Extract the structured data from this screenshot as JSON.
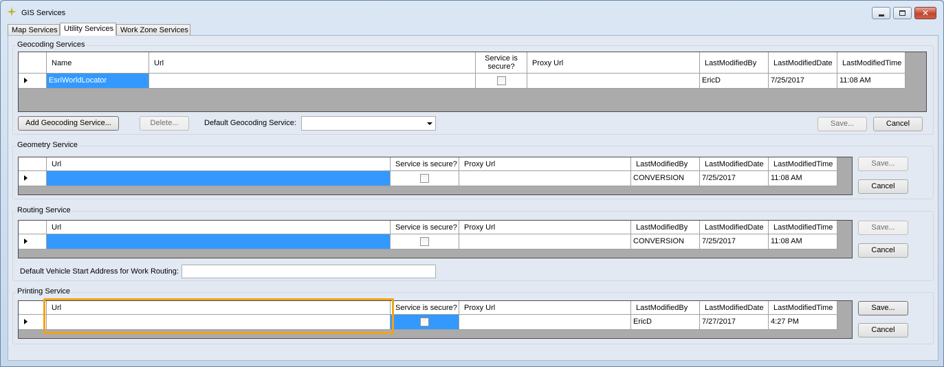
{
  "window": {
    "title": "GIS Services"
  },
  "tabs": [
    "Map Services",
    "Utility Services",
    "Work Zone Services"
  ],
  "geocoding": {
    "group_title": "Geocoding Services",
    "columns": [
      "Name",
      "Url",
      "Service is secure?",
      "Proxy Url",
      "LastModifiedBy",
      "LastModifiedDate",
      "LastModifiedTime"
    ],
    "row": {
      "name": "EsriWorldLocator",
      "url": "",
      "secure": false,
      "proxy_url": "",
      "modified_by": "EricD",
      "modified_date": "7/25/2017",
      "modified_time": "11:08 AM"
    },
    "add_button": "Add Geocoding Service...",
    "delete_button": "Delete...",
    "default_label": "Default Geocoding Service:",
    "default_value": "",
    "save_button": "Save...",
    "cancel_button": "Cancel"
  },
  "geometry": {
    "group_title": "Geometry Service",
    "columns": [
      "Url",
      "Service is secure?",
      "Proxy Url",
      "LastModifiedBy",
      "LastModifiedDate",
      "LastModifiedTime"
    ],
    "row": {
      "url": "",
      "secure": false,
      "proxy_url": "",
      "modified_by": "CONVERSION",
      "modified_date": "7/25/2017",
      "modified_time": "11:08 AM"
    },
    "save_button": "Save...",
    "cancel_button": "Cancel"
  },
  "routing": {
    "group_title": "Routing Service",
    "columns": [
      "Url",
      "Service is secure?",
      "Proxy Url",
      "LastModifiedBy",
      "LastModifiedDate",
      "LastModifiedTime"
    ],
    "row": {
      "url": "",
      "secure": false,
      "proxy_url": "",
      "modified_by": "CONVERSION",
      "modified_date": "7/25/2017",
      "modified_time": "11:08 AM"
    },
    "start_address_label": "Default Vehicle Start Address for Work Routing:",
    "start_address_value": "",
    "save_button": "Save...",
    "cancel_button": "Cancel"
  },
  "printing": {
    "group_title": "Printing Service",
    "columns": [
      "Url",
      "Service is secure?",
      "Proxy Url",
      "LastModifiedBy",
      "LastModifiedDate",
      "LastModifiedTime"
    ],
    "row": {
      "url": "",
      "secure": false,
      "proxy_url": "",
      "modified_by": "EricD",
      "modified_date": "7/27/2017",
      "modified_time": "4:27 PM"
    },
    "save_button": "Save...",
    "cancel_button": "Cancel"
  },
  "colors": {
    "selection": "#3399ff",
    "highlight": "#f2a31a",
    "grid_background": "#ababab"
  }
}
